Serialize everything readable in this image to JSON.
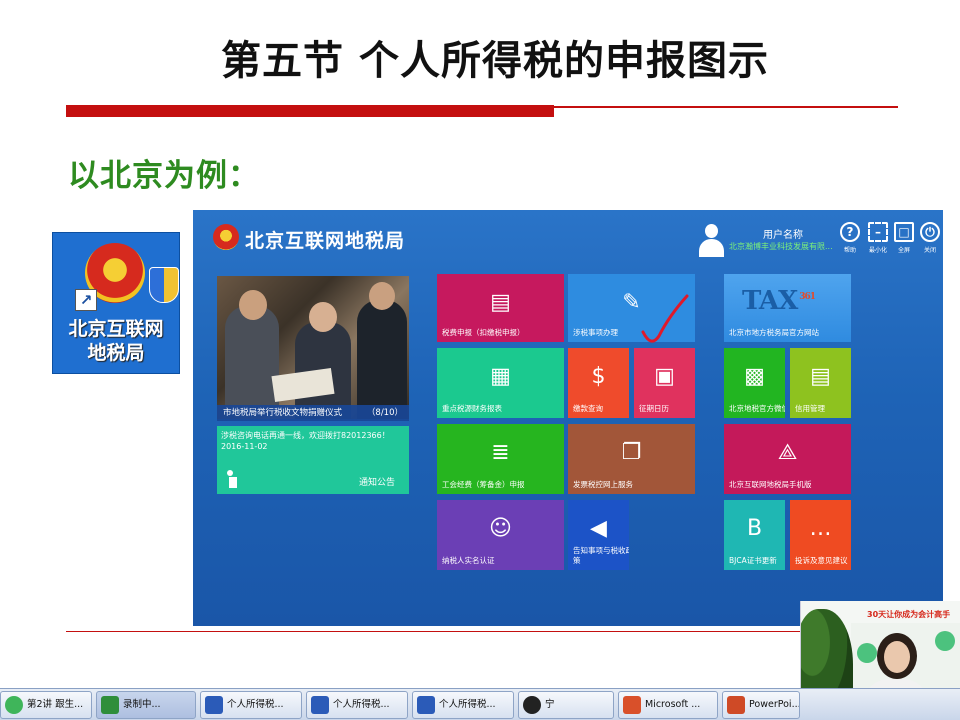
{
  "slide": {
    "title": "第五节 个人所得税的申报图示",
    "subtitle": "以北京为例："
  },
  "shortcut": {
    "label_line1": "北京互联网",
    "label_line2": "地税局",
    "arrow_icon": "shortcut-arrow-icon"
  },
  "portal": {
    "site_title": "北京互联网地税局",
    "user_label": "用户名称",
    "user_company": "北京瀚博丰业科技发展有限...",
    "toolbar": [
      {
        "glyph": "?",
        "label": "帮助",
        "icon": "help-icon"
      },
      {
        "glyph": "–",
        "label": "最小化",
        "icon": "minimize-icon"
      },
      {
        "glyph": "□",
        "label": "全屏",
        "icon": "fullscreen-icon"
      },
      {
        "glyph": "⏻",
        "label": "关闭",
        "icon": "power-icon"
      }
    ],
    "news_caption": "市地税局举行税收文物捐赠仪式",
    "news_page": "（8/10）",
    "notice_text": "涉税咨询电话再通一线，欢迎拨打82012366！ 2016-11-02",
    "notice_label": "通知公告",
    "tiles": [
      {
        "label": "税费申报（扣缴税申报）",
        "color": "#c6195e",
        "icon": "▤"
      },
      {
        "label": "涉税事项办理",
        "color": "#2e8ce0",
        "icon": "✎"
      },
      {
        "label": "重点税源财务报表",
        "color": "#1bc98f",
        "icon": "▦"
      },
      {
        "label": "缴款查询",
        "color": "#ef4b2c",
        "icon": "$"
      },
      {
        "label": "征期日历",
        "color": "#e0325e",
        "icon": "▣"
      },
      {
        "label": "工会经费（筹备金）申报",
        "color": "#26b51f",
        "icon": "≣"
      },
      {
        "label": "发票税控网上服务",
        "color": "#a25639",
        "icon": "❐"
      },
      {
        "label": "纳税人实名认证",
        "color": "#6b3fb5",
        "icon": "☺"
      },
      {
        "label": "告知事项与税收政策",
        "color": "#1c53c7",
        "icon": "◀"
      },
      {
        "label": "北京市地方税务局官方网站",
        "color": "#2f8be0",
        "icon": ""
      },
      {
        "label": "北京地税官方微信",
        "color": "#22b521",
        "icon": "▩"
      },
      {
        "label": "信用管理",
        "color": "#8ec21f",
        "icon": "▤"
      },
      {
        "label": "北京互联网地税局手机版",
        "color": "#c4195a",
        "icon": "⟁"
      },
      {
        "label": "BJCA证书更新",
        "color": "#1fb7b3",
        "icon": "B"
      },
      {
        "label": "投诉及意见建议",
        "color": "#ef4b22",
        "icon": "…"
      }
    ],
    "tax_brand": "TAX",
    "tax_sup": "361"
  },
  "taskbar": {
    "items": [
      {
        "label": "第2讲 跟生...",
        "color": "#3fb55a"
      },
      {
        "label": "录制中...",
        "color": "#2f8e3a"
      },
      {
        "label": "个人所得税...",
        "color": "#2b5bb8"
      },
      {
        "label": "个人所得税...",
        "color": "#2b5bb8"
      },
      {
        "label": "个人所得税...",
        "color": "#2b5bb8"
      },
      {
        "label": "宁",
        "color": "#222222"
      },
      {
        "label": "Microsoft ...",
        "color": "#d9502a"
      },
      {
        "label": "PowerPoi...",
        "color": "#cf4a26"
      }
    ]
  },
  "webcam": {
    "banner": "30天让你成为会计高手"
  },
  "colors": {
    "title_red": "#c40f0f",
    "subtitle_green": "#2e8b20",
    "portal_blue": "#1e63b6"
  }
}
